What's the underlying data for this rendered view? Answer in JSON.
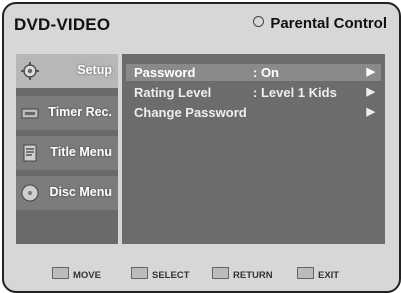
{
  "header": {
    "title": "DVD-VIDEO",
    "mode_label": "Parental Control"
  },
  "sidebar": {
    "items": [
      {
        "label": "Setup",
        "icon": "setup-icon"
      },
      {
        "label": "Timer Rec.",
        "icon": "timer-icon"
      },
      {
        "label": "Title Menu",
        "icon": "title-menu-icon"
      },
      {
        "label": "Disc Menu",
        "icon": "disc-menu-icon"
      }
    ]
  },
  "main": {
    "rows": [
      {
        "name": "Password",
        "value": ": On",
        "arrow": "▶"
      },
      {
        "name": "Rating Level",
        "value": ": Level 1 Kids",
        "arrow": "▶"
      },
      {
        "name": "Change Password",
        "value": "",
        "arrow": "▶"
      }
    ]
  },
  "footer": {
    "hints": [
      {
        "label": "MOVE"
      },
      {
        "label": "SELECT"
      },
      {
        "label": "RETURN"
      },
      {
        "label": "EXIT"
      }
    ]
  },
  "colors": {
    "background": "#d7d7d7",
    "panel": "#6c6c6c",
    "selected": "#8a8a8a"
  }
}
